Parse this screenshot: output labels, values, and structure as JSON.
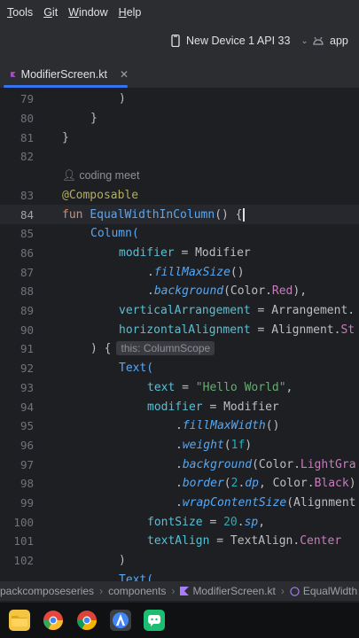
{
  "menu": [
    "Tools",
    "Git",
    "Window",
    "Help"
  ],
  "toolbar": {
    "device": "New Device 1 API 33",
    "run_config": "app"
  },
  "tab": {
    "label": "ModifierScreen.kt"
  },
  "editor": {
    "author_hint": "coding meet",
    "scope_hint": "this: ColumnScope",
    "lines": [
      "79",
      "80",
      "81",
      "82",
      "83",
      "84",
      "85",
      "86",
      "87",
      "88",
      "89",
      "90",
      "91",
      "92",
      "93",
      "94",
      "95",
      "96",
      "97",
      "98",
      "99",
      "100",
      "101",
      "102"
    ],
    "code": {
      "l79": ")",
      "l80": "}",
      "l81": "}",
      "l83": "@Composable",
      "l84_kw": "fun",
      "l84_fn": "EqualWidthInColumn",
      "l84_rest": "() {",
      "l85": "Column(",
      "l86_a": "modifier",
      "l86_b": " = Modifier",
      "l87_a": ".",
      "l87_b": "fillMaxSize",
      "l87_c": "()",
      "l88_a": ".",
      "l88_b": "background",
      "l88_c": "(Color.",
      "l88_d": "Red",
      "l88_e": "),",
      "l89_a": "verticalArrangement",
      "l89_b": " = Arrangement.",
      "l90_a": "horizontalAlignment",
      "l90_b": " = Alignment.",
      "l90_c": "St",
      "l91": ") {",
      "l92": "Text(",
      "l93_a": "text",
      "l93_b": " = ",
      "l93_c": "\"Hello World\"",
      "l93_d": ",",
      "l94_a": "modifier",
      "l94_b": " = Modifier",
      "l95_b": "fillMaxWidth",
      "l96_b": "weight",
      "l96_c": "(",
      "l96_d": "1f",
      "l96_e": ")",
      "l97_b": "background",
      "l97_c": "(Color.",
      "l97_d": "LightGra",
      "l98_b": "border",
      "l98_c": "(",
      "l98_d": "2",
      "l98_e": ".",
      "l98_f": "dp",
      "l98_g": ", Color.",
      "l98_h": "Black",
      "l98_i": ")",
      "l99_b": "wrapContentSize",
      "l99_c": "(Alignment",
      "l100_a": "fontSize",
      "l100_b": " = ",
      "l100_c": "20",
      "l100_d": ".",
      "l100_e": "sp",
      "l100_f": ",",
      "l101_a": "textAlign",
      "l101_b": " = TextAlign.",
      "l101_c": "Center",
      "l102": ")",
      "l103": "Text("
    }
  },
  "breadcrumb": [
    "packcomposeseries",
    "components",
    "ModifierScreen.kt",
    "EqualWidth"
  ],
  "taskbar": [
    "file-explorer",
    "chrome-dev",
    "chrome",
    "android-studio",
    "messenger"
  ]
}
